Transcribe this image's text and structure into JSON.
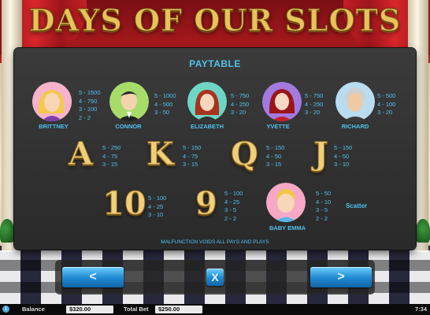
{
  "logo": {
    "text": "DAYS OF OUR SLOTS"
  },
  "paytable": {
    "title": "PAYTABLE",
    "characters": [
      {
        "name": "BRITTNEY",
        "pays": [
          "5 - 1500",
          "4 - 750",
          "3 - 100",
          "2 - 2"
        ]
      },
      {
        "name": "CONNOR",
        "pays": [
          "5 - 1000",
          "4 - 500",
          "3 - 50"
        ]
      },
      {
        "name": "ELIZABETH",
        "pays": [
          "5 - 750",
          "4 - 250",
          "3 - 20"
        ]
      },
      {
        "name": "YVETTE",
        "pays": [
          "5 - 750",
          "4 - 250",
          "3 - 20"
        ]
      },
      {
        "name": "RICHARD",
        "pays": [
          "5 - 500",
          "4 - 100",
          "3 - 20"
        ]
      }
    ],
    "letters": [
      {
        "symbol": "A",
        "pays": [
          "5 - 250",
          "4 - 75",
          "3 - 15"
        ]
      },
      {
        "symbol": "K",
        "pays": [
          "5 - 150",
          "4 - 75",
          "3 - 15"
        ]
      },
      {
        "symbol": "Q",
        "pays": [
          "5 - 150",
          "4 - 50",
          "3 - 15"
        ]
      },
      {
        "symbol": "J",
        "pays": [
          "5 - 150",
          "4 - 50",
          "3 - 10"
        ]
      }
    ],
    "numbers": [
      {
        "symbol": "10",
        "pays": [
          "5 - 100",
          "4 - 25",
          "3 - 10"
        ]
      },
      {
        "symbol": "9",
        "pays": [
          "5 - 100",
          "4 - 25",
          "3 - 5",
          "2 - 2"
        ]
      }
    ],
    "scatter": {
      "name": "BABY EMMA",
      "pays": [
        "5 - 50",
        "4 - 10",
        "3 - 5",
        "2 - 2"
      ],
      "label": "Scatter"
    },
    "disclaimer": "MALFUNCTION VOIDS ALL PAYS AND PLAYS"
  },
  "nav": {
    "prev_label": "<",
    "close_label": "X",
    "next_label": ">"
  },
  "status_bar": {
    "info_icon": "i",
    "balance_label": "Balance",
    "balance_value": "$320.00",
    "total_bet_label": "Total Bet",
    "total_bet_value": "$250.00",
    "clock": "7:34"
  },
  "colors": {
    "accent": "#4fc3ee",
    "gold": "#f0cf7a",
    "panel": "#2f2f2f",
    "button": "#1e88d0"
  }
}
